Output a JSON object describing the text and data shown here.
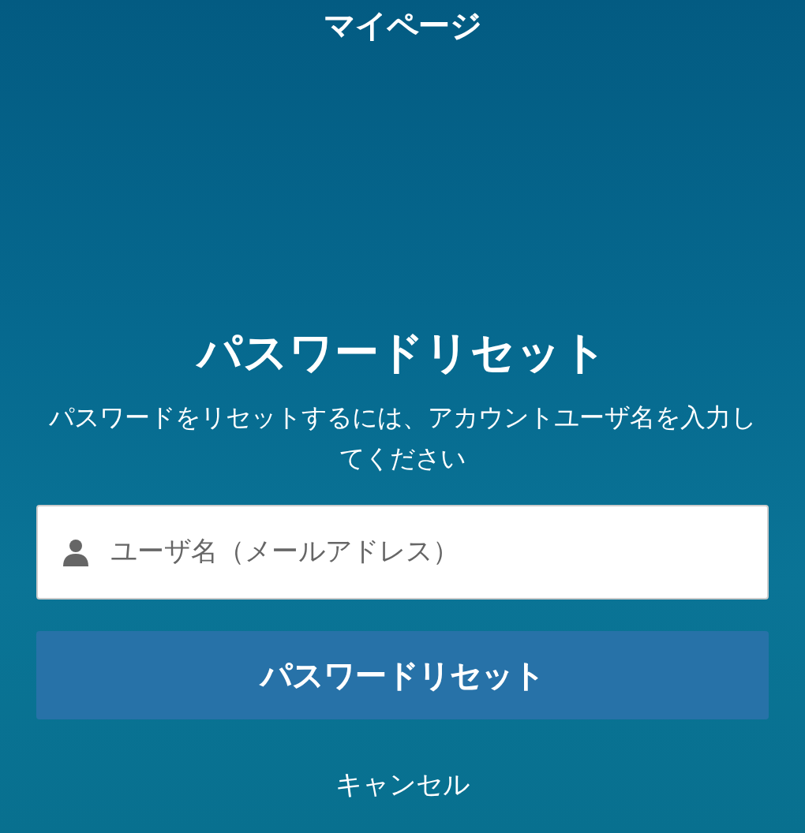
{
  "header": {
    "title": "マイページ"
  },
  "form": {
    "heading": "パスワードリセット",
    "instructions": "パスワードをリセットするには、アカウントユーザ名を入力してください",
    "username": {
      "placeholder": "ユーザ名（メールアドレス）"
    },
    "submit": "パスワードリセット",
    "cancel": "キャンセル"
  }
}
